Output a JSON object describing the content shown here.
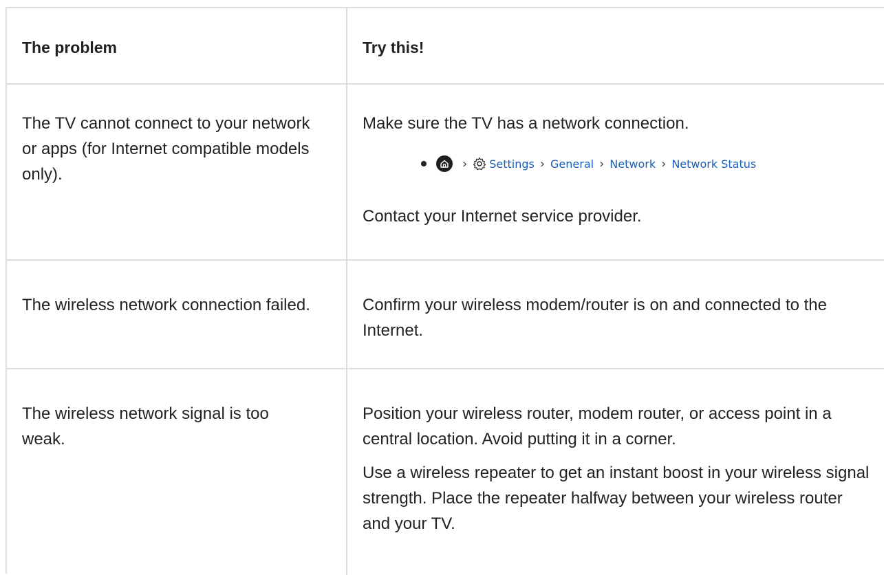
{
  "table": {
    "headers": {
      "problem": "The problem",
      "try_this": "Try this!"
    },
    "rows": [
      {
        "problem": "The TV cannot connect to your network or apps (for Internet compatible models only).",
        "try_this": [
          "Make sure the TV has a network connection.",
          "Contact your Internet service provider."
        ],
        "menu_path": [
          "Settings",
          "General",
          "Network",
          "Network Status"
        ]
      },
      {
        "problem": "The wireless network connection failed.",
        "try_this": [
          "Confirm your wireless modem/router is on and connected to the Internet."
        ]
      },
      {
        "problem": "The wireless network signal is too weak.",
        "try_this": [
          "Position your wireless router, modem router, or access point in a central location. Avoid putting it in a corner.",
          "Use a wireless repeater to get an instant boost in your wireless signal strength. Place the repeater halfway between your wireless router and your TV."
        ]
      }
    ]
  },
  "icons": {
    "home": "home-icon",
    "settings": "gear-icon",
    "separator": "chevron-right-icon"
  },
  "colors": {
    "link": "#1a5fb4",
    "border": "#dddddd",
    "text": "#222222"
  }
}
